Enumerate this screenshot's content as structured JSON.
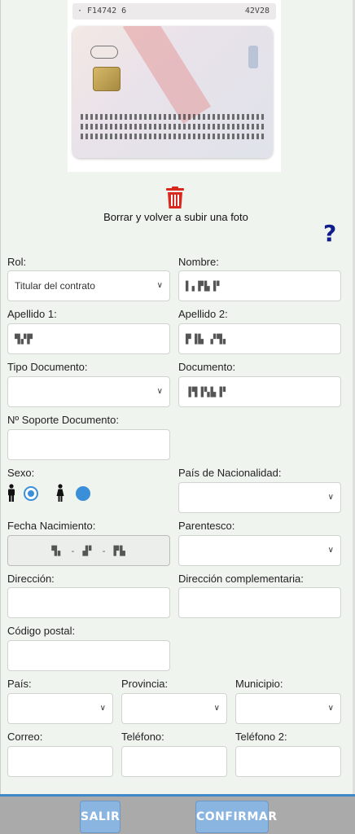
{
  "photo": {
    "strip_left": "· F14742 6",
    "strip_right": "42V28"
  },
  "actions": {
    "reupload_label": "Borrar y volver a subir una foto",
    "help_label": "?"
  },
  "form": {
    "rol": {
      "label": "Rol:",
      "value": "Titular del contrato"
    },
    "nombre": {
      "label": "Nombre:",
      "value": "▌▖▛▙▐▘"
    },
    "apellido1": {
      "label": "Apellido 1:",
      "value": "▜▞▛"
    },
    "apellido2": {
      "label": "Apellido 2:",
      "value": "▛▐▙ ▞▜▖"
    },
    "tipo_documento": {
      "label": "Tipo Documento:",
      "value": ""
    },
    "documento": {
      "label": "Documento:",
      "value": "▐▜▐▚▙▐▘"
    },
    "soporte": {
      "label": "Nº Soporte Documento:",
      "value": ""
    },
    "sexo": {
      "label": "Sexo:",
      "selected": "male"
    },
    "pais_nacionalidad": {
      "label": "País de Nacionalidad:",
      "value": ""
    },
    "fecha_nacimiento": {
      "label": "Fecha Nacimiento:",
      "value": "▜▖ -  ▟▘  -  ▛▙"
    },
    "parentesco": {
      "label": "Parentesco:",
      "value": ""
    },
    "direccion": {
      "label": "Dirección:",
      "value": ""
    },
    "direccion_complementaria": {
      "label": "Dirección complementaria:",
      "value": ""
    },
    "codigo_postal": {
      "label": "Código postal:",
      "value": ""
    },
    "pais": {
      "label": "País:",
      "value": ""
    },
    "provincia": {
      "label": "Provincia:",
      "value": ""
    },
    "municipio": {
      "label": "Municipio:",
      "value": ""
    },
    "correo": {
      "label": "Correo:",
      "value": ""
    },
    "telefono": {
      "label": "Teléfono:",
      "value": ""
    },
    "telefono2": {
      "label": "Teléfono 2:",
      "value": ""
    }
  },
  "footer": {
    "salir_label": "SALIR",
    "confirmar_label": "CONFIRMAR"
  },
  "colors": {
    "accent": "#3a8fd8",
    "help": "#0f1d8c",
    "trash": "#d9281e",
    "button": "#8ab5e0"
  }
}
